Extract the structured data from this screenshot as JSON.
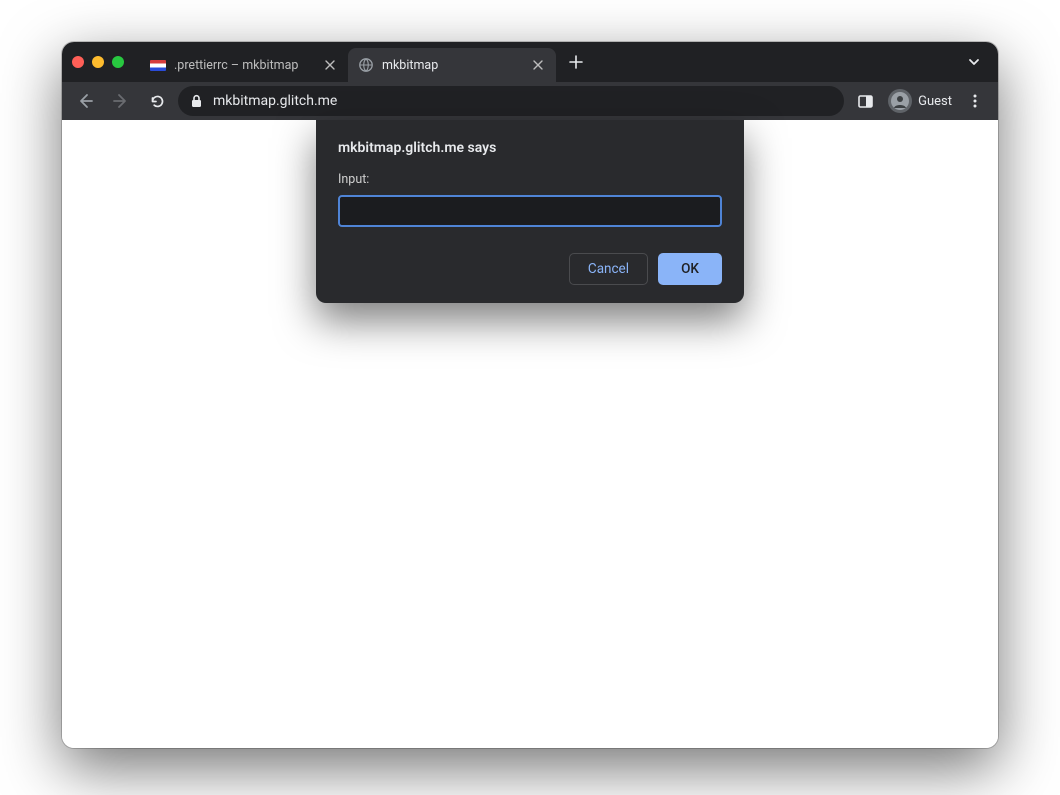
{
  "tabs": [
    {
      "title": ".prettierrc – mkbitmap",
      "active": false
    },
    {
      "title": "mkbitmap",
      "active": true
    }
  ],
  "omnibox": {
    "url": "mkbitmap.glitch.me"
  },
  "profile": {
    "label": "Guest"
  },
  "dialog": {
    "origin_says": "mkbitmap.glitch.me says",
    "label": "Input:",
    "value": "",
    "cancel": "Cancel",
    "ok": "OK"
  }
}
